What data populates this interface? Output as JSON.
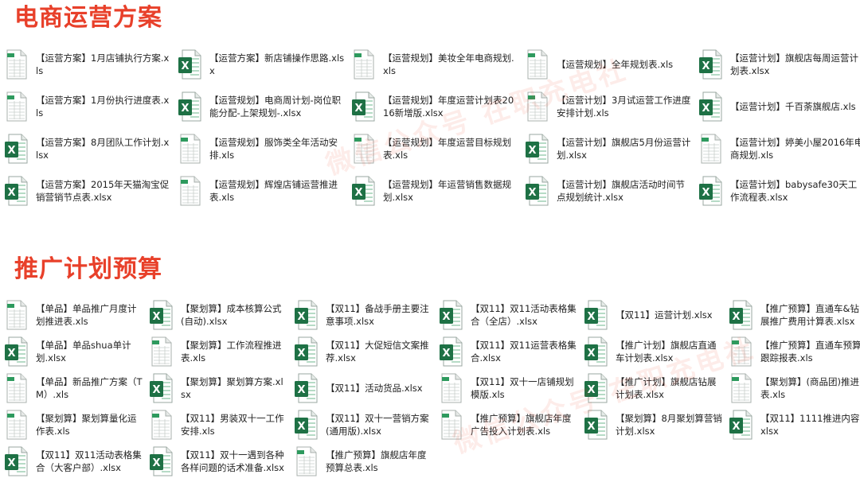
{
  "sections": [
    {
      "title": "电商运营方案",
      "items": [
        {
          "name": "【运营方案】1月店铺执行方案.xls",
          "icon": "xls-file-icon"
        },
        {
          "name": "【运营方案】新店铺操作思路.xlsx",
          "icon": "xlsx-file-icon"
        },
        {
          "name": "【运营规划】美妆全年电商规划.xls",
          "icon": "xls-file-icon"
        },
        {
          "name": "【运营规划】全年规划表.xls",
          "icon": "xls-file-icon"
        },
        {
          "name": "【运营计划】旗舰店每周运营计划表.xlsx",
          "icon": "xlsx-file-icon"
        },
        {
          "name": "【运营方案】1月份执行进度表.xls",
          "icon": "xls-file-icon"
        },
        {
          "name": "【运营规划】电商周计划-岗位职能分配-上架规划-.xlsx",
          "icon": "xlsx-file-icon"
        },
        {
          "name": "【运营规划】年度运营计划表2016新增版.xlsx",
          "icon": "xlsx-file-icon"
        },
        {
          "name": "【运营计划】3月试运营工作进度安排计划.xls",
          "icon": "xls-file-icon"
        },
        {
          "name": "【运营计划】千百荼旗舰店.xls",
          "icon": "xlsx-file-icon"
        },
        {
          "name": "【运营方案】8月团队工作计划.xlsx",
          "icon": "xlsx-file-icon"
        },
        {
          "name": "【运营规划】服饰类全年活动安排.xls",
          "icon": "xls-file-icon"
        },
        {
          "name": "【运营规划】年度运营目标规划表.xls",
          "icon": "xls-file-icon"
        },
        {
          "name": "【运营计划】旗舰店5月份运营计划.xlsx",
          "icon": "xlsx-file-icon"
        },
        {
          "name": "【运营计划】婷美小屋2016年电商规划.xls",
          "icon": "xls-file-icon"
        },
        {
          "name": "【运营方案】2015年天猫淘宝促销营销节点表.xlsx",
          "icon": "xlsx-file-icon"
        },
        {
          "name": "【运营规划】辉煌店铺运营推进表.xls",
          "icon": "xls-file-icon"
        },
        {
          "name": "【运营规划】年运营销售数据规划.xlsx",
          "icon": "xlsx-file-icon"
        },
        {
          "name": "【运营计划】旗舰店活动时间节点规划统计.xlsx",
          "icon": "xlsx-file-icon"
        },
        {
          "name": "【运营计划】babysafe30天工作流程表.xlsx",
          "icon": "xlsx-file-icon"
        }
      ]
    },
    {
      "title": "推广计划预算",
      "items": [
        {
          "name": "【单品】单品推广月度计划推进表.xls",
          "icon": "xls-file-icon"
        },
        {
          "name": "【聚划算】成本核算公式(自动).xlsx",
          "icon": "xlsx-file-icon"
        },
        {
          "name": "【双11】备战手册主要注意事项.xlsx",
          "icon": "xlsx-file-icon"
        },
        {
          "name": "【双11】双11活动表格集合（全店）.xlsx",
          "icon": "xlsx-file-icon"
        },
        {
          "name": "【双11】运营计划.xlsx",
          "icon": "xlsx-file-icon"
        },
        {
          "name": "【推广预算】直通车&钻展推广费用计算表.xlsx",
          "icon": "xlsx-file-icon"
        },
        {
          "name": "【单品】单品shua单计划.xlsx",
          "icon": "xlsx-file-icon"
        },
        {
          "name": "【聚划算】工作流程推进表.xls",
          "icon": "xls-file-icon"
        },
        {
          "name": "【双11】大促短信文案推荐.xlsx",
          "icon": "xlsx-file-icon"
        },
        {
          "name": "【双11】双11运营表格集合.xlsx",
          "icon": "xlsx-file-icon"
        },
        {
          "name": "【推广计划】旗舰店直通车计划表.xlsx",
          "icon": "xlsx-file-icon"
        },
        {
          "name": "【推广预算】直通车预算跟踪报表.xls",
          "icon": "xls-file-icon"
        },
        {
          "name": "【单品】新品推广方案（TM）.xls",
          "icon": "xls-file-icon"
        },
        {
          "name": "【聚划算】聚划算方案.xlsx",
          "icon": "xlsx-file-icon"
        },
        {
          "name": "【双11】活动货品.xlsx",
          "icon": "xlsx-file-icon"
        },
        {
          "name": "【双11】双十一店铺规划模版.xls",
          "icon": "xls-file-icon"
        },
        {
          "name": "【推广计划】旗舰店钻展计划表.xlsx",
          "icon": "xlsx-file-icon"
        },
        {
          "name": "【聚划算】(商品团)推进表.xls",
          "icon": "xls-file-icon"
        },
        {
          "name": "【聚划算】聚划算量化运作表.xls",
          "icon": "xls-file-icon"
        },
        {
          "name": "【双11】男装双十一工作安排.xls",
          "icon": "xls-file-icon"
        },
        {
          "name": "【双11】双十一营销方案(通用版).xlsx",
          "icon": "xlsx-file-icon"
        },
        {
          "name": "【推广预算】旗舰店年度广告投入计划表.xls",
          "icon": "xls-file-icon"
        },
        {
          "name": "【聚划算】8月聚划算营销计划.xlsx",
          "icon": "xlsx-file-icon"
        },
        {
          "name": "【双11】1111推进内容.xlsx",
          "icon": "xlsx-file-icon"
        },
        {
          "name": "【双11】双11活动表格集合（大客户部）.xlsx",
          "icon": "xlsx-file-icon"
        },
        {
          "name": "【双11】双十一遇到各种各样问题的话术准备.xlsx",
          "icon": "xlsx-file-icon"
        },
        {
          "name": "【推广预算】旗舰店年度预算总表.xls",
          "icon": "xls-file-icon"
        }
      ]
    }
  ],
  "watermark": "微信公众号 在职充电社",
  "colors": {
    "title": "#e8402a",
    "excel_green": "#1e7145",
    "excel_green_light": "#2e9a5e"
  }
}
